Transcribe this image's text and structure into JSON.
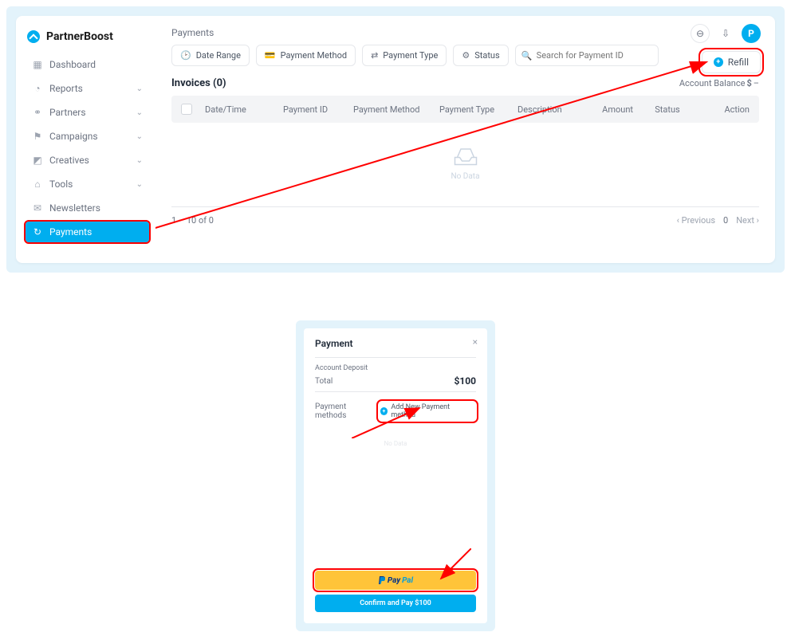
{
  "brand": {
    "name": "PartnerBoost"
  },
  "sidebar": {
    "items": [
      {
        "label": "Dashboard",
        "icon": "▦",
        "expandable": false
      },
      {
        "label": "Reports",
        "icon": "◔",
        "expandable": true
      },
      {
        "label": "Partners",
        "icon": "⚭",
        "expandable": true
      },
      {
        "label": "Campaigns",
        "icon": "⚑",
        "expandable": true
      },
      {
        "label": "Creatives",
        "icon": "◩",
        "expandable": true
      },
      {
        "label": "Tools",
        "icon": "⌂",
        "expandable": true
      },
      {
        "label": "Newsletters",
        "icon": "✉",
        "expandable": false
      },
      {
        "label": "Payments",
        "icon": "↻",
        "expandable": false
      }
    ]
  },
  "header": {
    "title": "Payments",
    "profile_initial": "P"
  },
  "filters": {
    "date_range": "Date Range",
    "payment_method": "Payment Method",
    "payment_type": "Payment Type",
    "status": "Status",
    "search_placeholder": "Search for Payment ID"
  },
  "refill": {
    "label": "Refill"
  },
  "invoices": {
    "title": "Invoices (0)",
    "account_balance_label": "Account Balance",
    "currency": "$",
    "balance_value": "–",
    "columns": {
      "date": "Date/Time",
      "pid": "Payment ID",
      "pm": "Payment Method",
      "pt": "Payment Type",
      "desc": "Description",
      "amt": "Amount",
      "st": "Status",
      "ac": "Action"
    },
    "no_data": "No Data"
  },
  "pager": {
    "range": "1 – 10 of 0",
    "prev": "Previous",
    "cur": "0",
    "next": "Next"
  },
  "modal": {
    "title": "Payment",
    "deposit_label": "Account Deposit",
    "total_label": "Total",
    "total_value": "$100",
    "methods_label": "Payment methods",
    "add_method_label": "Add New Payment method",
    "no_data": "No Data",
    "paypal_p": "Pay",
    "paypal_pal": "Pal",
    "confirm_label": "Confirm and Pay $100"
  }
}
